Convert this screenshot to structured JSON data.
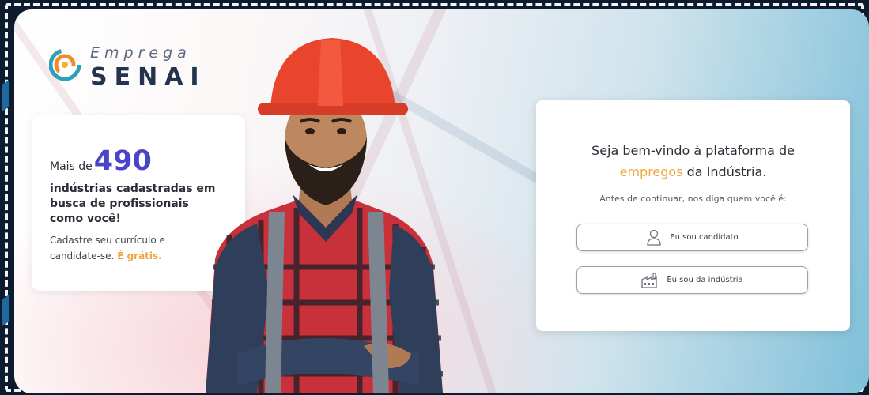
{
  "brand": {
    "top": "Emprega",
    "bottom": "SENAI"
  },
  "stats": {
    "prefix": "Mais de",
    "number": "490",
    "description": "indústrias cadastradas em busca de profissionais como você!",
    "cta_text": "Cadastre seu currículo e candidate-se.",
    "cta_free": "É grátis."
  },
  "welcome": {
    "title_line1": "Seja bem-vindo à plataforma de",
    "title_highlight": "empregos",
    "title_line2_rest": "da Indústria.",
    "subtitle": "Antes de continuar, nos diga quem você é:",
    "candidate_button": "Eu sou candidato",
    "industry_button": "Eu sou da indústria"
  },
  "colors": {
    "accent_orange": "#f0a640",
    "number_purple": "#4a45c8",
    "helmet_red": "#e8452c"
  }
}
